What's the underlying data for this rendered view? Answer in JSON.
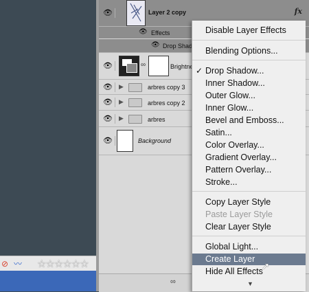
{
  "layers": {
    "layer2copy": "Layer 2 copy",
    "effects": "Effects",
    "dropshadow": "Drop Shadow",
    "brightness": "Brightness/Contrast 1",
    "arbres3": "arbres copy 3",
    "arbres2": "arbres copy 2",
    "arbres": "arbres",
    "background": "Background",
    "fx": "fx"
  },
  "menu": {
    "disable": "Disable Layer Effects",
    "blending": "Blending Options...",
    "drop_shadow": "Drop Shadow...",
    "inner_shadow": "Inner Shadow...",
    "outer_glow": "Outer Glow...",
    "inner_glow": "Inner Glow...",
    "bevel": "Bevel and Emboss...",
    "satin": "Satin...",
    "color_overlay": "Color Overlay...",
    "gradient_overlay": "Gradient Overlay...",
    "pattern_overlay": "Pattern Overlay...",
    "stroke": "Stroke...",
    "copy_style": "Copy Layer Style",
    "paste_style": "Paste Layer Style",
    "clear_style": "Clear Layer Style",
    "global_light": "Global Light...",
    "create_layer": "Create Layer",
    "hide_effects": "Hide All Effects",
    "checked_item": "Drop Shadow...",
    "highlighted_item": "Create Layer"
  },
  "colors": {
    "menu_highlight": "#6b7a8f",
    "dock": "#3b68b8",
    "canvas": "#3d4a54"
  }
}
